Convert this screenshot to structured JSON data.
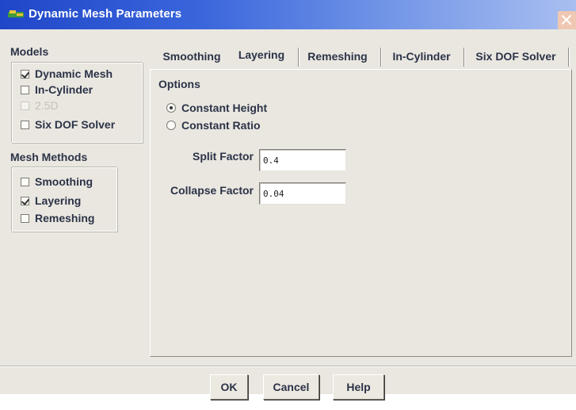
{
  "window": {
    "title": "Dynamic Mesh Parameters",
    "accent_color": "#1f46c8"
  },
  "models": {
    "label": "Models",
    "items": [
      {
        "label": "Dynamic Mesh",
        "checked": true,
        "enabled": true
      },
      {
        "label": "In-Cylinder",
        "checked": false,
        "enabled": true
      },
      {
        "label": "2.5D",
        "checked": false,
        "enabled": false
      },
      {
        "label": "Six DOF Solver",
        "checked": false,
        "enabled": true
      }
    ]
  },
  "mesh_methods": {
    "label": "Mesh Methods",
    "items": [
      {
        "label": "Smoothing",
        "checked": false
      },
      {
        "label": "Layering",
        "checked": true
      },
      {
        "label": "Remeshing",
        "checked": false
      }
    ]
  },
  "tabs": [
    {
      "label": "Smoothing",
      "active": false
    },
    {
      "label": "Layering",
      "active": true
    },
    {
      "label": "Remeshing",
      "active": false
    },
    {
      "label": "In-Cylinder",
      "active": false
    },
    {
      "label": "Six DOF Solver",
      "active": false
    }
  ],
  "layering": {
    "options_label": "Options",
    "options": [
      {
        "label": "Constant Height",
        "selected": true
      },
      {
        "label": "Constant Ratio",
        "selected": false
      }
    ],
    "split_factor": {
      "label": "Split Factor",
      "value": "0.4"
    },
    "collapse_factor": {
      "label": "Collapse Factor",
      "value": "0.04"
    }
  },
  "buttons": {
    "ok": "OK",
    "cancel": "Cancel",
    "help": "Help"
  },
  "icons": {
    "title": "fluent-app-icon",
    "close": "close-icon"
  }
}
